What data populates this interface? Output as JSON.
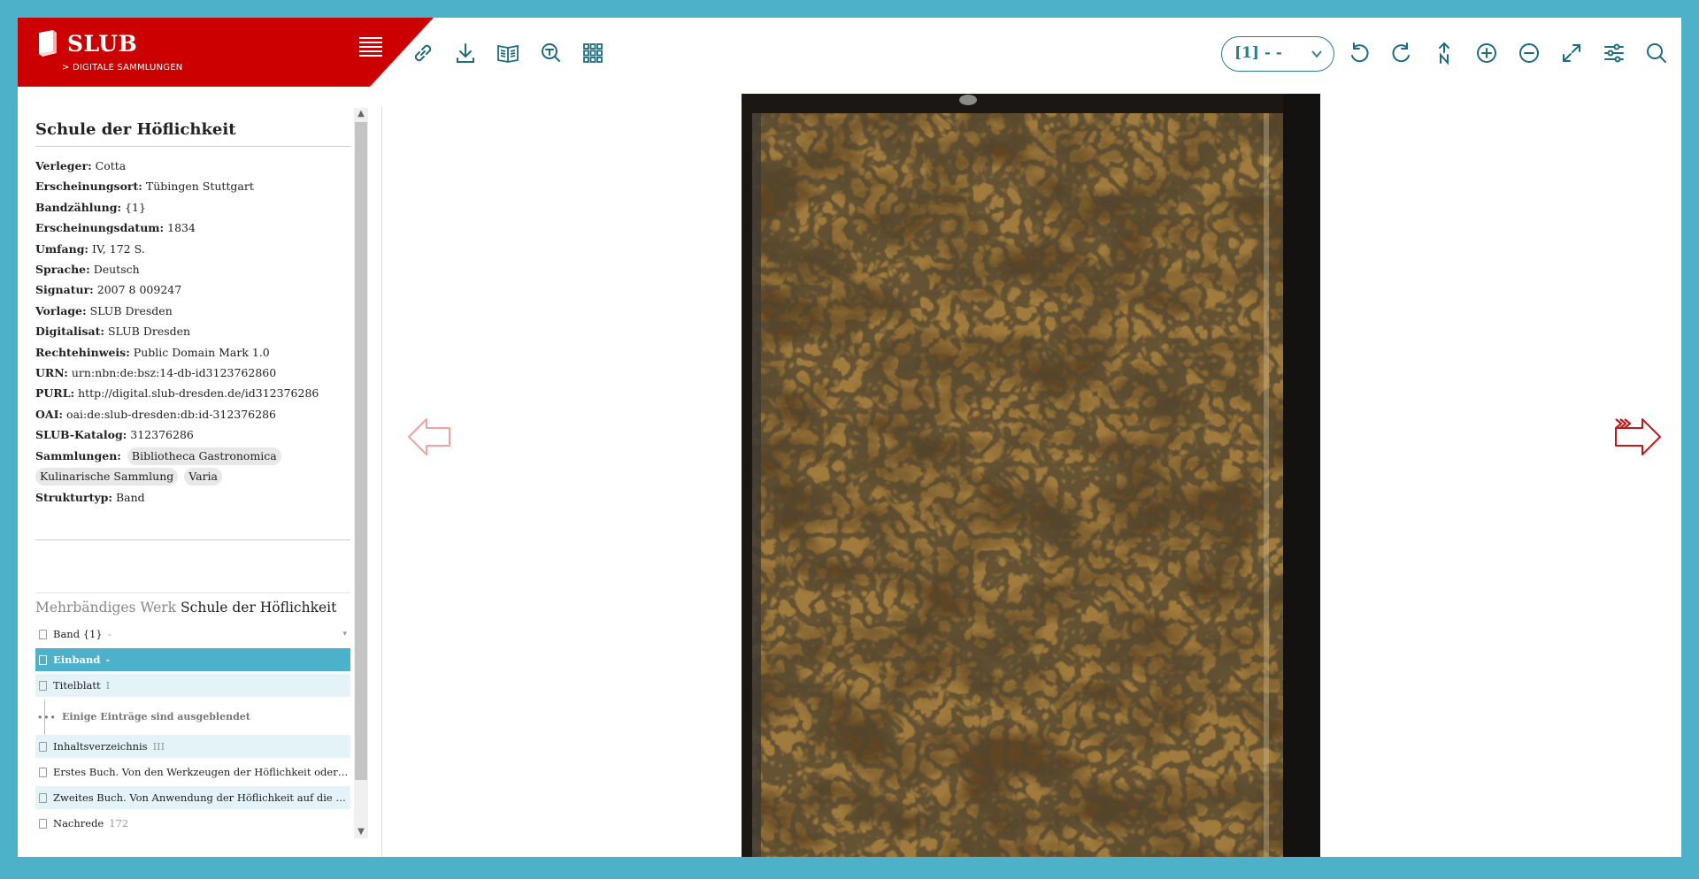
{
  "brand": {
    "name": "SLUB",
    "subtitle": "> DIGITALE SAMMLUNGEN",
    "color": "#cc0000"
  },
  "toolbar": {
    "left_icons": [
      "link-icon",
      "download-icon",
      "book-icon",
      "search-fulltext-icon",
      "grid-icon"
    ],
    "page_select_value": "[1] - -",
    "right_icons": [
      "rotate-left-icon",
      "rotate-right-icon",
      "north-reset-icon",
      "zoom-in-icon",
      "zoom-out-icon",
      "fullscreen-icon",
      "settings-sliders-icon",
      "search-icon"
    ],
    "accent": "#1d6b80"
  },
  "metadata": {
    "title": "Schule der Höflichkeit",
    "rows": [
      {
        "label": "Verleger:",
        "value": "Cotta"
      },
      {
        "label": "Erscheinungsort:",
        "value": "Tübingen Stuttgart"
      },
      {
        "label": "Bandzählung:",
        "value": "{1}"
      },
      {
        "label": "Erscheinungsdatum:",
        "value": "1834"
      },
      {
        "label": "Umfang:",
        "value": "IV, 172 S."
      },
      {
        "label": "Sprache:",
        "value": "Deutsch"
      },
      {
        "label": "Signatur:",
        "value": "2007 8 009247"
      },
      {
        "label": "Vorlage:",
        "value": "SLUB Dresden"
      },
      {
        "label": "Digitalisat:",
        "value": "SLUB Dresden"
      },
      {
        "label": "Rechtehinweis:",
        "value": "Public Domain Mark 1.0"
      },
      {
        "label": "URN:",
        "value": "urn:nbn:de:bsz:14-db-id3123762860"
      },
      {
        "label": "PURL:",
        "value": "http://digital.slub-dresden.de/id312376286"
      },
      {
        "label": "OAI:",
        "value": "oai:de:slub-dresden:db:id-312376286"
      },
      {
        "label": "SLUB-Katalog:",
        "value": "312376286"
      }
    ],
    "collections_label": "Sammlungen:",
    "collections": [
      "Bibliotheca Gastronomica",
      "Kulinarische Sammlung",
      "Varia"
    ],
    "structure_type_label": "Strukturtyp:",
    "structure_type": "Band"
  },
  "structure": {
    "prefix": "Mehrbändiges Werk",
    "title": "Schule der Höflichkeit",
    "items": [
      {
        "label": "Band {1}",
        "page": "-",
        "state": "normal"
      },
      {
        "label": "Einband",
        "page": "-",
        "state": "active"
      },
      {
        "label": "Titelblatt",
        "page": "I",
        "state": "light"
      },
      {
        "label": "Inhaltsverzeichnis",
        "page": "III",
        "state": "light"
      },
      {
        "label": "Erstes Buch. Von den Werkzeugen der Höflichkeit oder v...",
        "page": "",
        "state": "normal"
      },
      {
        "label": "Zweites Buch. Von Anwendung der Höflichkeit auf die b...",
        "page": "",
        "state": "light"
      },
      {
        "label": "Nachrede",
        "page": "172",
        "state": "normal"
      }
    ],
    "hidden_notice": "Einige Einträge sind ausgeblendet"
  },
  "viewer": {
    "prev_icon": "arrow-left-icon",
    "next_icon": "arrow-right-icon",
    "image_description_icon": "marbled-book-cover"
  }
}
